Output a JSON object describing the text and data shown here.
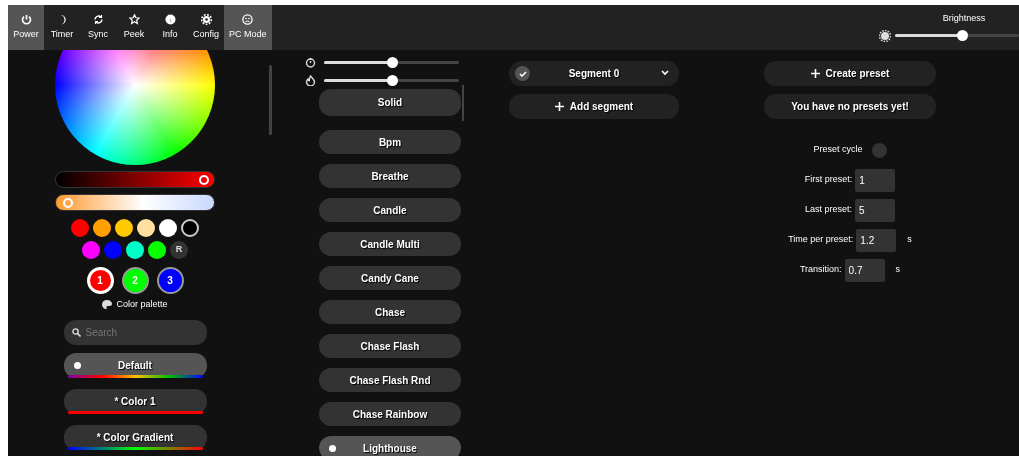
{
  "tabs": [
    {
      "label": "Power",
      "selected": true
    },
    {
      "label": "Timer",
      "selected": false
    },
    {
      "label": "Sync",
      "selected": false
    },
    {
      "label": "Peek",
      "selected": false
    },
    {
      "label": "Info",
      "selected": false
    },
    {
      "label": "Config",
      "selected": false
    },
    {
      "label": "PC Mode",
      "selected": true
    }
  ],
  "brightness": {
    "label": "Brightness",
    "level": 0.54
  },
  "color_sliders": [
    {
      "kind": "value",
      "level": 0.96
    },
    {
      "kind": "kelvin",
      "level": 0.04
    }
  ],
  "quick_color_rows": [
    [
      {
        "color": "#ff0000"
      },
      {
        "color": "#ffa000"
      },
      {
        "color": "#ffc800"
      },
      {
        "color": "#ffe0a0"
      },
      {
        "color": "#ffffff"
      },
      {
        "color": "#000000"
      }
    ],
    [
      {
        "color": "#ff00ff"
      },
      {
        "color": "#0000ff"
      },
      {
        "color": "#00ffc8"
      },
      {
        "color": "#08ff00"
      }
    ]
  ],
  "random_button": "R",
  "color_slots": [
    {
      "label": "1",
      "color": "#ff0000",
      "selected": true
    },
    {
      "label": "2",
      "color": "#00ff00",
      "selected": false
    },
    {
      "label": "3",
      "color": "#0000ff",
      "selected": false
    }
  ],
  "palette_heading": "Color palette",
  "palette_search": {
    "placeholder": "Search"
  },
  "palettes": [
    {
      "name": "Default",
      "selected": true
    },
    {
      "name": "* Color 1",
      "selected": false
    },
    {
      "name": "* Color Gradient",
      "selected": false
    }
  ],
  "effect_sliders": [
    {
      "level": 0.5
    },
    {
      "level": 0.5
    }
  ],
  "effects": [
    {
      "name": "Solid",
      "selected": false
    },
    {
      "name": "Bpm",
      "selected": false
    },
    {
      "name": "Breathe",
      "selected": false
    },
    {
      "name": "Candle",
      "selected": false
    },
    {
      "name": "Candle Multi",
      "selected": false
    },
    {
      "name": "Candy Cane",
      "selected": false
    },
    {
      "name": "Chase",
      "selected": false
    },
    {
      "name": "Chase Flash",
      "selected": false
    },
    {
      "name": "Chase Flash Rnd",
      "selected": false
    },
    {
      "name": "Chase Rainbow",
      "selected": false
    },
    {
      "name": "Lighthouse",
      "selected": true
    }
  ],
  "segments": [
    {
      "name": "Segment 0",
      "checked": true
    }
  ],
  "add_segment": "Add segment",
  "presets": {
    "create": "Create preset",
    "empty_message": "You have no presets yet!",
    "cycle": {
      "label": "Preset cycle",
      "on": false
    },
    "fields": [
      {
        "label": "First preset:",
        "value": "1"
      },
      {
        "label": "Last preset:",
        "value": "5"
      },
      {
        "label": "Time per preset:",
        "value": "1.2",
        "unit": "s"
      },
      {
        "label": "Transition:",
        "value": "0.7",
        "unit": "s"
      }
    ]
  }
}
